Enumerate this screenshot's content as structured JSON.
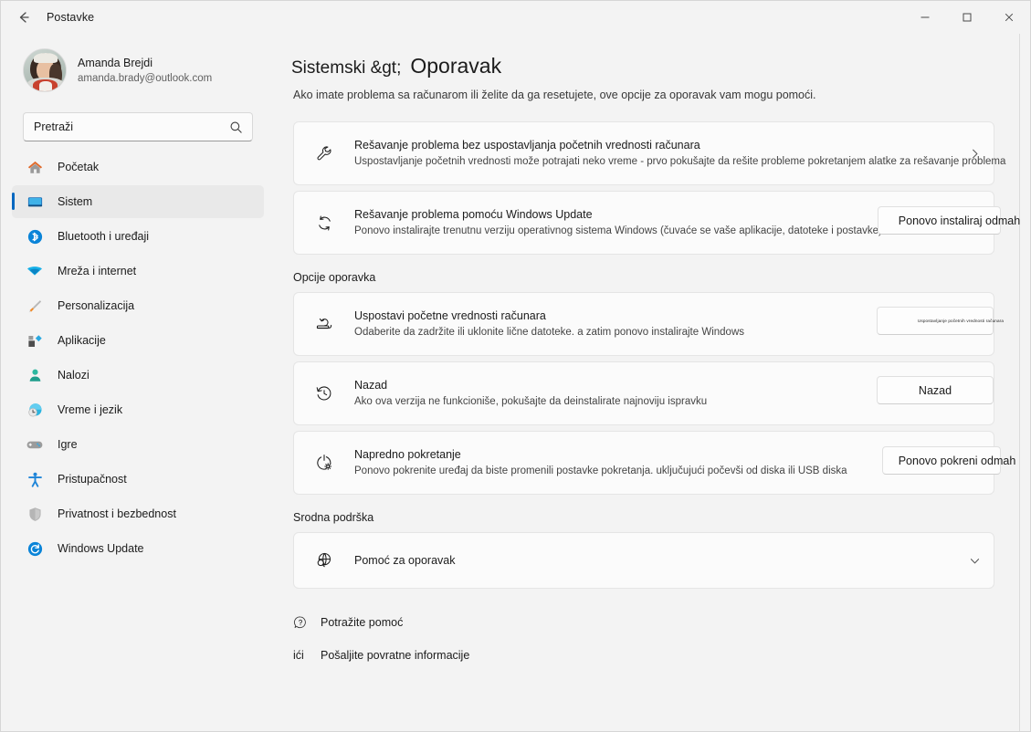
{
  "window": {
    "title": "Postavke",
    "back_icon": "back-arrow-icon",
    "minimize_label": "─",
    "maximize_label": "□",
    "close_label": "✕"
  },
  "sidebar": {
    "profile": {
      "name": "Amanda Brejdi",
      "email": "amanda.brady@outlook.com"
    },
    "search": {
      "placeholder": "Pretraži",
      "icon": "search-icon"
    },
    "items": [
      {
        "label": "Početak",
        "icon": "home-icon",
        "selected": false
      },
      {
        "label": "Sistem",
        "icon": "system-monitor-icon",
        "selected": true
      },
      {
        "label": "Bluetooth i uređaji",
        "icon": "bluetooth-icon",
        "selected": false
      },
      {
        "label": "Mreža i internet",
        "icon": "wifi-icon",
        "selected": false
      },
      {
        "label": "Personalizacija",
        "icon": "paintbrush-icon",
        "selected": false
      },
      {
        "label": "Aplikacije",
        "icon": "apps-icon",
        "selected": false
      },
      {
        "label": "Nalozi",
        "icon": "account-person-icon",
        "selected": false
      },
      {
        "label": "Vreme i jezik",
        "icon": "clock-globe-icon",
        "selected": false
      },
      {
        "label": "Igre",
        "icon": "gamepad-icon",
        "selected": false
      },
      {
        "label": "Pristupačnost",
        "icon": "accessibility-person-icon",
        "selected": false
      },
      {
        "label": "Privatnost i bezbednost",
        "icon": "shield-icon",
        "selected": false
      },
      {
        "label": "Windows Update",
        "icon": "update-refresh-icon",
        "selected": false
      }
    ]
  },
  "main": {
    "breadcrumb_parent": "Sistemski &gt;",
    "breadcrumb_current": "Oporavak",
    "subtitle": "Ako imate problema sa računarom ili želite da ga resetujete, ove opcije za oporavak vam mogu pomoći.",
    "cards": [
      {
        "icon": "wrench-icon",
        "title": "Rešavanje problema bez uspostavljanja početnih vrednosti računara",
        "desc": "Uspostavljanje početnih vrednosti može potrajati neko vreme - prvo pokušajte da rešite probleme pokretanjem alatke za rešavanje problema",
        "trailing": "chevron-right-icon"
      },
      {
        "icon": "refresh-circular-icon",
        "title": "Rešavanje problema pomoću Windows Update",
        "desc": "Ponovo instalirajte trenutnu verziju operativnog sistema Windows (čuvaće se vaše aplikacije, datoteke i postavke)",
        "button": "Ponovo instaliraj odmah"
      }
    ],
    "recovery_section_title": "Opcije oporavka",
    "recovery_cards": [
      {
        "icon": "reset-pc-icon",
        "title": "Uspostavi početne vrednosti računara",
        "desc": "Odaberite da zadržite ili uklonite lične datoteke. a zatim ponovo instalirajte Windows",
        "button": "Uspostavljanje početnih vrednosti računara"
      },
      {
        "icon": "history-clock-icon",
        "title": "Nazad",
        "desc": "Ako ova verzija ne funkcioniše, pokušajte da deinstalirate najnoviju ispravku",
        "button": "Nazad"
      },
      {
        "icon": "power-gear-icon",
        "title": "Napredno pokretanje",
        "desc": "Ponovo pokrenite uređaj da biste promenili postavke pokretanja. uključujući počevši od diska ili USB diska",
        "button": "Ponovo pokreni odmah"
      }
    ],
    "support_section_title": "Srodna podrška",
    "support_card": {
      "icon": "globe-search-icon",
      "title": "Pomoć za oporavak",
      "trailing": "chevron-down-icon"
    },
    "footer_links": [
      {
        "icon": "question-bubble-icon",
        "icon_text": "",
        "label": "Potražite pomoć"
      },
      {
        "icon": "feedback-icon",
        "icon_text": "ići",
        "label": "Pošaljite povratne informacije"
      }
    ]
  },
  "colors": {
    "accent": "#0067c0",
    "page_bg": "#f3f3f3",
    "card_bg": "#fbfbfb"
  }
}
